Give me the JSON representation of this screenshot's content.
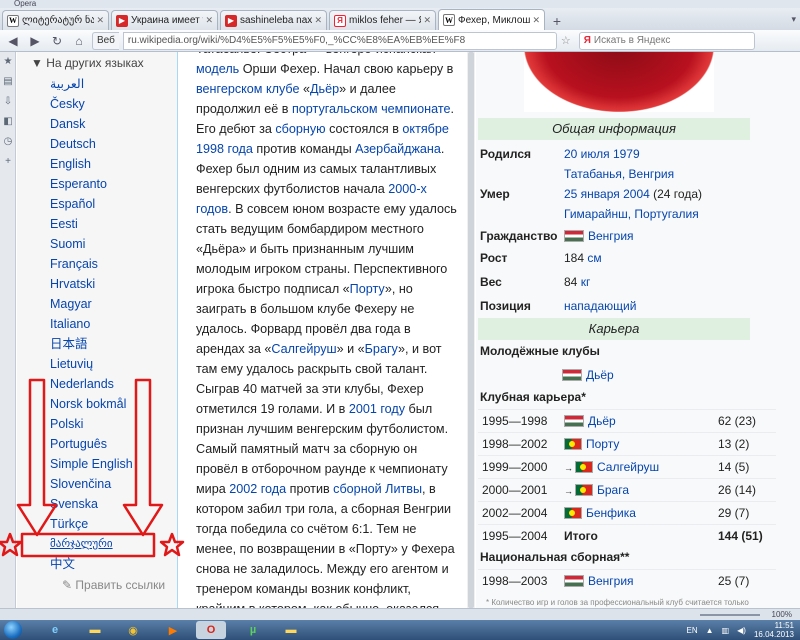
{
  "window": {
    "title": "Opera"
  },
  "tabs": [
    {
      "label": "ლიტერატურ ნაწარმოებ...",
      "favicon": "W",
      "type": "wiki",
      "active": false
    },
    {
      "label": "Украина имеет талант...",
      "favicon": "▶",
      "type": "yt",
      "active": false
    },
    {
      "label": "sashineleba naxet yvela...",
      "favicon": "▶",
      "type": "yt",
      "active": false
    },
    {
      "label": "miklos feher — Яндекс...",
      "favicon": "Я",
      "type": "ya",
      "active": false
    },
    {
      "label": "Фехер, Миклош — Ви...",
      "favicon": "W",
      "type": "wiki",
      "active": true
    }
  ],
  "toolbar": {
    "back": "◀",
    "forward": "▶",
    "reload": "↻",
    "home": "⌂",
    "web_badge": "Веб",
    "url": "ru.wikipedia.org/wiki/%D4%E5%F5%E5%F0,_%CC%E8%EA%EB%EE%F8",
    "search_placeholder": "Искать в Яндекс",
    "search_engine": "Я"
  },
  "sidebar": {
    "heading": "На других языках",
    "languages": [
      "العربية",
      "Česky",
      "Dansk",
      "Deutsch",
      "English",
      "Esperanto",
      "Español",
      "Eesti",
      "Suomi",
      "Français",
      "Hrvatski",
      "Magyar",
      "Italiano",
      "日本語",
      "Lietuvių",
      "Nederlands",
      "Norsk bokmål",
      "Polski",
      "Português",
      "Simple English",
      "Slovenčina",
      "Svenska",
      "Türkçe",
      "მარჯალური",
      "中文"
    ],
    "selected_index": 23,
    "edit_links": "Править ссылки"
  },
  "article": {
    "paragraph": [
      {
        "t": "Татабанье. Сестра — венгеро-испанская "
      },
      {
        "t": "модель",
        "link": true
      },
      {
        "t": " Орши Фехер. Начал свою карьеру в "
      },
      {
        "t": "венгерском клубе",
        "link": true
      },
      {
        "t": " «"
      },
      {
        "t": "Дьёр",
        "link": true
      },
      {
        "t": "» и далее продолжил её в "
      },
      {
        "t": "португальском чемпионате",
        "link": true
      },
      {
        "t": ". Его дебют за "
      },
      {
        "t": "сборную",
        "link": true
      },
      {
        "t": " состоялся в "
      },
      {
        "t": "октябре",
        "link": true
      },
      {
        "t": " "
      },
      {
        "t": "1998 года",
        "link": true
      },
      {
        "t": " против команды "
      },
      {
        "t": "Азербайджана",
        "link": true
      },
      {
        "t": ". Фехер был одним из самых талантливых венгерских футболистов начала "
      },
      {
        "t": "2000-х годов",
        "link": true
      },
      {
        "t": ". В совсем юном возрасте ему удалось стать ведущим бомбардиром местного «Дьёра» и быть признанным лучшим молодым игроком страны. Перспективного игрока быстро подписал «"
      },
      {
        "t": "Порту",
        "link": true
      },
      {
        "t": "», но заиграть в большом клубе Фехеру не удалось. Форвард провёл два года в арендах за «"
      },
      {
        "t": "Салгейруш",
        "link": true
      },
      {
        "t": "» и «"
      },
      {
        "t": "Брагу",
        "link": true
      },
      {
        "t": "», и вот там ему удалось раскрыть свой талант. Сыграв 40 матчей за эти клубы, Фехер отметился 19 голами. И в "
      },
      {
        "t": "2001 году",
        "link": true
      },
      {
        "t": " был признан лучшим венгерским футболистом. Самый памятный матч за сборную он провёл в отборочном раунде к чемпионату мира "
      },
      {
        "t": "2002 года",
        "link": true
      },
      {
        "t": " против "
      },
      {
        "t": "сборной Литвы",
        "link": true
      },
      {
        "t": ", в котором забил три гола, а сборная Венгрии тогда победила со счётом 6:1. Тем не менее, по возвращении в «Порту» у Фехера снова не заладилось. Между его агентом и тренером команды возник конфликт, крайним в котором, как обычно, оказался игрок. В итоге Фехер и не ушёл из клуба, и не попал в первую команду"
      }
    ]
  },
  "infobox": {
    "general_header": "Общая информация",
    "born_label": "Родился",
    "born_date": "20 июля 1979",
    "born_place": "Татабанья, Венгрия",
    "died_label": "Умер",
    "died_date": "25 января 2004",
    "died_age": " (24 года)",
    "died_place": "Гимарайнш, Португалия",
    "citizenship_label": "Гражданство",
    "citizenship": "Венгрия",
    "height_label": "Рост",
    "height_value": "184",
    "height_unit": "см",
    "weight_label": "Вес",
    "weight_value": "84",
    "weight_unit": "кг",
    "position_label": "Позиция",
    "position": "нападающий",
    "career_header": "Карьера",
    "youth_label": "Молодёжные клубы",
    "youth_club": "Дьёр",
    "club_career_label": "Клубная карьера*",
    "club_rows": [
      {
        "years": "1995—1998",
        "club": "Дьёр",
        "flag": "hu",
        "loan": false,
        "stats": "62 (23)"
      },
      {
        "years": "1998—2002",
        "club": "Порту",
        "flag": "pt",
        "loan": false,
        "stats": "13 (2)"
      },
      {
        "years": "1999—2000",
        "club": "Салгейруш",
        "flag": "pt",
        "loan": true,
        "stats": "14 (5)"
      },
      {
        "years": "2000—2001",
        "club": "Брага",
        "flag": "pt",
        "loan": true,
        "stats": "26 (14)"
      },
      {
        "years": "2002—2004",
        "club": "Бенфика",
        "flag": "pt",
        "loan": false,
        "stats": "29 (7)"
      }
    ],
    "total_years": "1995—2004",
    "total_label": "Итого",
    "total_stats": "144 (51)",
    "national_label": "Национальная сборная**",
    "national_years": "1998—2003",
    "national_team": "Венгрия",
    "national_stats": "25 (7)",
    "footnote": "* Количество игр и голов за профессиональный клуб считается только"
  },
  "status": {
    "zoom": "100%"
  },
  "taskbar": {
    "lang": "EN",
    "time": "11:51",
    "date": "16.04.2013"
  },
  "colors": {
    "link": "#0645ad",
    "annotation": "#e01818",
    "infobox_header": "#dff0e0"
  }
}
